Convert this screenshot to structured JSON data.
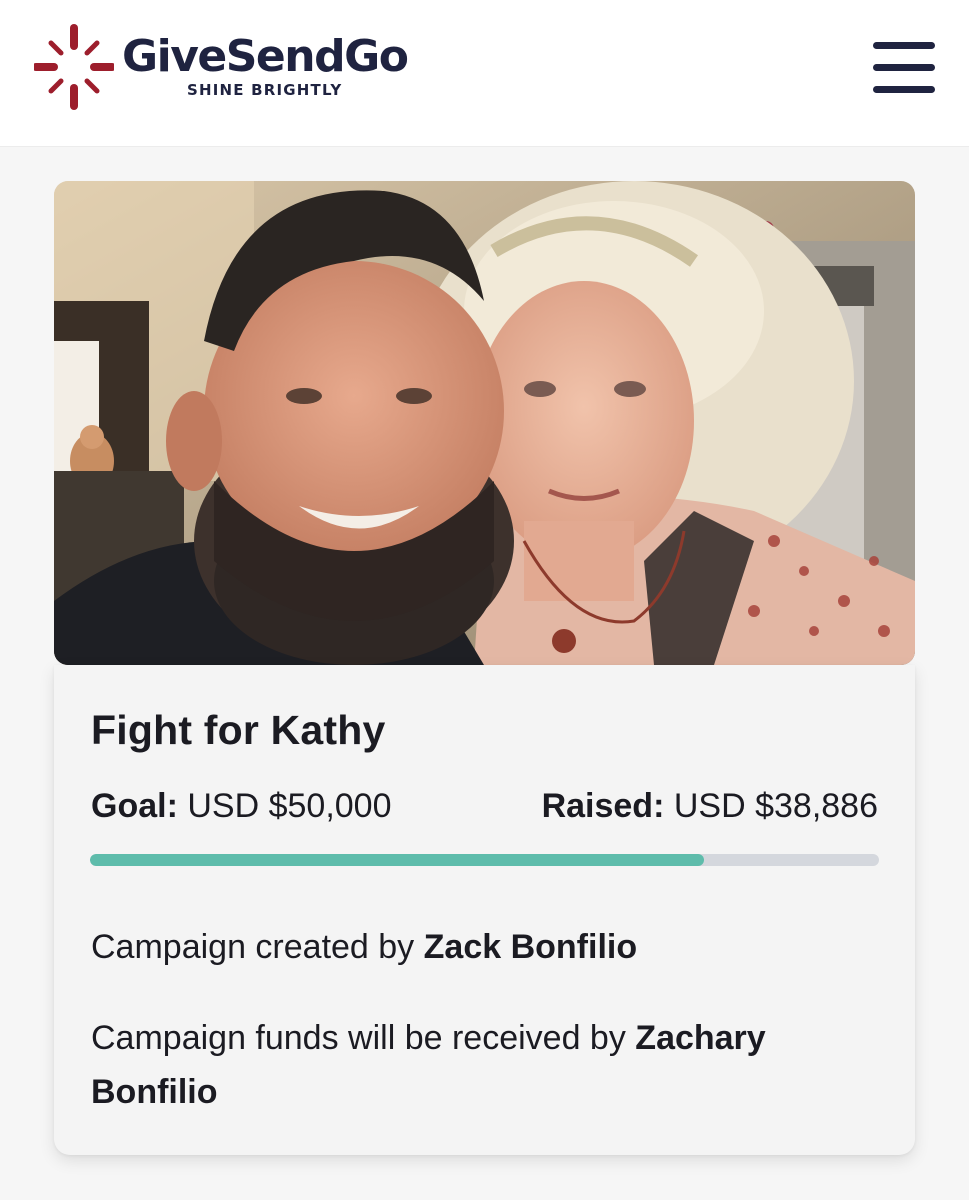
{
  "brand": {
    "name": "GiveSendGo",
    "tagline": "SHINE BRIGHTLY",
    "logo_color": "#9d1e2c",
    "text_color": "#1f2340"
  },
  "header": {
    "menu_icon": "hamburger-menu-icon"
  },
  "campaign": {
    "photo_alt": "Campaign photo",
    "title": "Fight for Kathy",
    "goal_label": "Goal:",
    "goal_value": "USD $50,000",
    "raised_label": "Raised:",
    "raised_value": "USD $38,886",
    "progress_fraction": 0.7777,
    "progress_color": "#5ebcab",
    "created_prefix": "Campaign created by",
    "created_by": "Zack Bonfilio",
    "received_prefix": "Campaign funds will be received by",
    "received_by": "Zachary Bonfilio"
  }
}
